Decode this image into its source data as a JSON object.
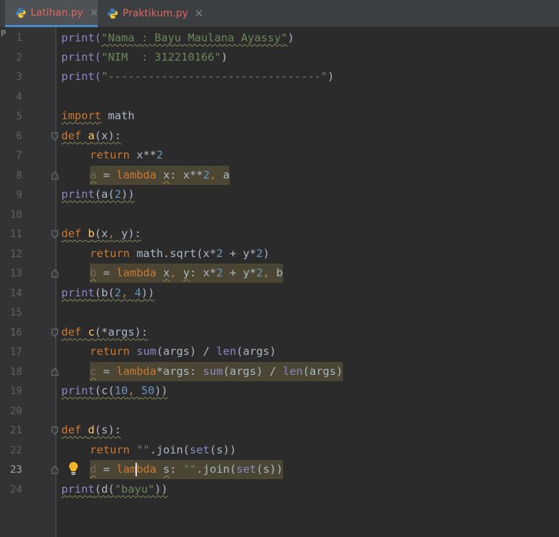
{
  "tabs": [
    {
      "label": "Latihan.py",
      "active": true
    },
    {
      "label": "Praktikum.py",
      "active": false
    }
  ],
  "close_glyph": "✕",
  "gutter_mark": "P",
  "line_numbers": [
    "1",
    "2",
    "3",
    "4",
    "5",
    "6",
    "7",
    "8",
    "9",
    "10",
    "11",
    "12",
    "13",
    "14",
    "15",
    "16",
    "17",
    "18",
    "19",
    "20",
    "21",
    "22",
    "23",
    "24"
  ],
  "current_line": "23",
  "code": {
    "l1": [
      "print(",
      "\"Nama : Bayu Maulana Ayassy\"",
      ")"
    ],
    "l2": [
      "print(",
      "\"NIM  : 312210166\"",
      ")"
    ],
    "l3": [
      "print(",
      "\"--------------------------------\"",
      ")"
    ],
    "l5": [
      "import",
      " math"
    ],
    "l6": [
      "def ",
      "a",
      "(x):"
    ],
    "l7": [
      "return",
      " x**",
      "2"
    ],
    "l8": [
      "a",
      " = ",
      "lambda",
      " ",
      "x",
      ": x**",
      "2",
      ", ",
      "a"
    ],
    "l9": [
      "print",
      "(a(",
      "2",
      "))"
    ],
    "l11": [
      "def ",
      "b",
      "(x",
      ", ",
      "y):"
    ],
    "l12": [
      "return",
      " math.sqrt(x*",
      "2",
      " + y*",
      "2",
      ")"
    ],
    "l13": [
      "b",
      " = ",
      "lambda",
      " ",
      "x",
      ", ",
      "y",
      ": x*",
      "2",
      " + y*",
      "2",
      ", ",
      "b"
    ],
    "l14": [
      "print",
      "(b(",
      "2",
      ", ",
      "4",
      "))"
    ],
    "l16": [
      "def ",
      "c",
      "(*args):"
    ],
    "l17": [
      "return",
      " ",
      "sum",
      "(args) / ",
      "len",
      "(args)"
    ],
    "l18": [
      "c",
      " = ",
      "lambda",
      "*args: ",
      "sum",
      "(args) / ",
      "len",
      "(args)"
    ],
    "l19": [
      "print",
      "(c(",
      "10",
      ", ",
      "50",
      "))"
    ],
    "l21": [
      "def ",
      "d",
      "(s):"
    ],
    "l22": [
      "return",
      " ",
      "\"\"",
      ".join(",
      "set",
      "(s))"
    ],
    "l23": [
      "d",
      " = ",
      "lam",
      "bda",
      " ",
      "s",
      ": ",
      "\"\"",
      ".join(",
      "set",
      "(s))"
    ],
    "l24": [
      "print",
      "(d(",
      "\"bayu\"",
      "))"
    ]
  },
  "colors": {
    "keyword": "#cc7832",
    "function": "#ffc66d",
    "builtin": "#8888c6",
    "string": "#6a8759",
    "number": "#6897bb",
    "text": "#a9b7c6",
    "tab_text": "#e0675f",
    "highlight": "#4a4633"
  },
  "icons": [
    "python-file-icon",
    "close-icon",
    "fold-marker-icon",
    "lightbulb-icon"
  ]
}
